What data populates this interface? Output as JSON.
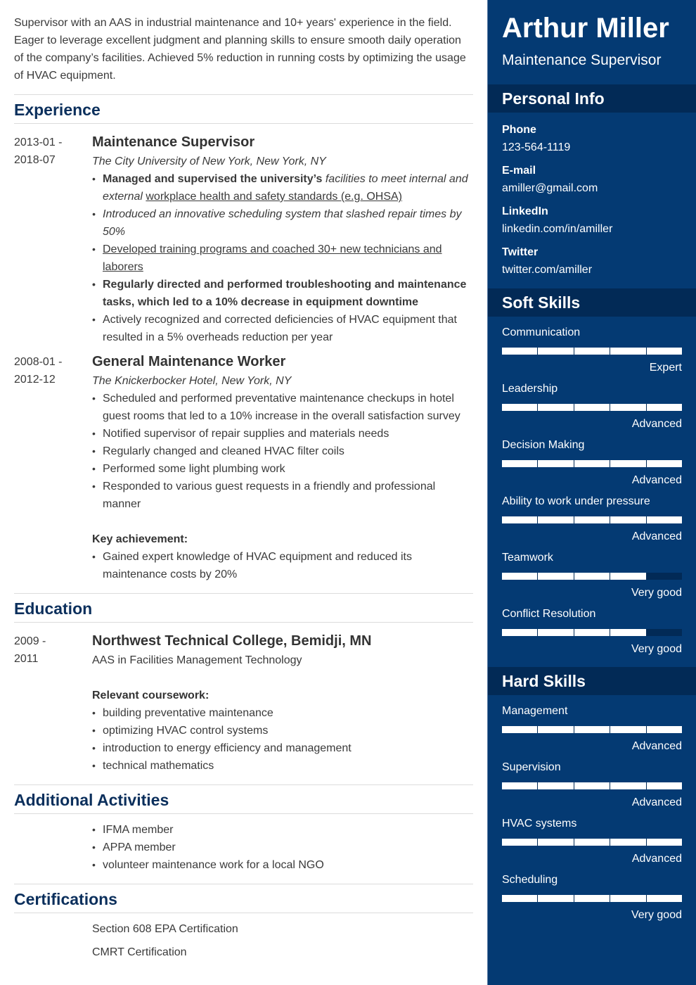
{
  "summary": "Supervisor with an AAS in industrial maintenance and 10+ years' experience in the field. Eager to leverage excellent judgment and planning skills to ensure smooth daily operation of the company’s facilities. Achieved 5% reduction in running costs by optimizing the usage of HVAC equipment.",
  "experience": {
    "heading": "Experience",
    "jobs": [
      {
        "dates_start": "2013-01 -",
        "dates_end": "2018-07",
        "title": "Maintenance Supervisor",
        "employer": "The City University of New York, New York, NY",
        "bullets": [
          {
            "part1_bold": "Managed and supervised the university’s ",
            "part2_italic": "facilities to meet internal and external",
            "part3_underline": "workplace health and safety standards (e.g. OHSA)"
          },
          {
            "text": "Introduced an innovative scheduling system that slashed repair times by 50%",
            "style": "italic"
          },
          {
            "text": "Developed training programs and coached 30+ new technicians and laborers",
            "style": "underline"
          },
          {
            "text": "Regularly directed and performed troubleshooting and maintenance tasks, which led to a 10% decrease in equipment downtime",
            "style": "bold"
          },
          {
            "text": "Actively recognized and corrected deficiencies of HVAC equipment that resulted in a 5% overheads reduction per year",
            "style": "normal"
          }
        ]
      },
      {
        "dates_start": "2008-01 -",
        "dates_end": "2012-12",
        "title": "General Maintenance Worker",
        "employer": "The Knickerbocker Hotel, New York, NY",
        "bullets": [
          "Scheduled and performed preventative maintenance checkups in hotel guest rooms that led to a 10% increase in the overall satisfaction survey",
          "Notified supervisor of repair supplies and materials needs",
          "Regularly changed and cleaned HVAC filter coils",
          "Performed some light plumbing work",
          "Responded to various guest requests in a friendly and professional manner"
        ],
        "key_label": "Key achievement:",
        "key_bullets": [
          "Gained expert knowledge of HVAC equipment and reduced its maintenance costs by 20%"
        ]
      }
    ]
  },
  "education": {
    "heading": "Education",
    "dates_start": "2009 -",
    "dates_end": "2011",
    "school": "Northwest Technical College, Bemidji, MN",
    "degree": "AAS in Facilities Management Technology",
    "coursework_label": "Relevant coursework:",
    "coursework": [
      "building preventative maintenance",
      "optimizing HVAC control systems",
      "introduction to energy efficiency and management",
      "technical mathematics"
    ]
  },
  "activities": {
    "heading": "Additional Activities",
    "items": [
      "IFMA member",
      "APPA member",
      "volunteer maintenance work for a local NGO"
    ]
  },
  "certifications": {
    "heading": "Certifications",
    "items": [
      "Section 608 EPA Certification",
      "CMRT Certification"
    ]
  },
  "sidebar": {
    "name": "Arthur Miller",
    "role": "Maintenance Supervisor",
    "personal": {
      "heading": "Personal Info",
      "fields": [
        {
          "label": "Phone",
          "value": "123-564-1119"
        },
        {
          "label": "E-mail",
          "value": "amiller@gmail.com"
        },
        {
          "label": "LinkedIn",
          "value": "linkedin.com/in/amiller"
        },
        {
          "label": "Twitter",
          "value": "twitter.com/amiller"
        }
      ]
    },
    "soft_skills": {
      "heading": "Soft Skills",
      "items": [
        {
          "name": "Communication",
          "level": "Expert",
          "filled": 5,
          "max": 5
        },
        {
          "name": "Leadership",
          "level": "Advanced",
          "filled": 5,
          "max": 5
        },
        {
          "name": "Decision Making",
          "level": "Advanced",
          "filled": 5,
          "max": 5
        },
        {
          "name": "Ability to work under pressure",
          "level": "Advanced",
          "filled": 5,
          "max": 5
        },
        {
          "name": "Teamwork",
          "level": "Very good",
          "filled": 4,
          "max": 5
        },
        {
          "name": "Conflict Resolution",
          "level": "Very good",
          "filled": 4,
          "max": 5
        }
      ]
    },
    "hard_skills": {
      "heading": "Hard Skills",
      "items": [
        {
          "name": "Management",
          "level": "Advanced",
          "filled": 5,
          "max": 5
        },
        {
          "name": "Supervision",
          "level": "Advanced",
          "filled": 5,
          "max": 5
        },
        {
          "name": "HVAC systems",
          "level": "Advanced",
          "filled": 5,
          "max": 5
        },
        {
          "name": "Scheduling",
          "level": "Very good",
          "filled": 5,
          "max": 5
        }
      ]
    }
  },
  "colors": {
    "sidebar_bg": "#043a73",
    "sidebar_heading_bg": "#022a56",
    "section_title": "#0b2f5c",
    "text": "#3a3a3a"
  }
}
